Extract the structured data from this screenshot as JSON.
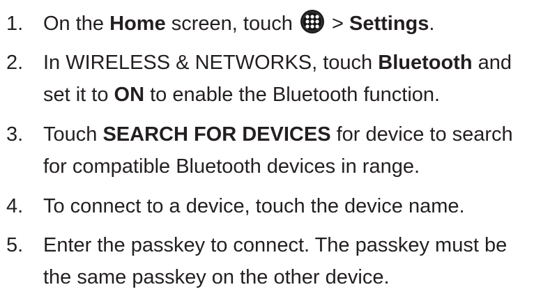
{
  "steps": [
    {
      "number": "1.",
      "lines": [
        {
          "before": "On the ",
          "bold1": "Home",
          "middle": " screen, touch ",
          "icon": "apps-grid-icon",
          "after": " > ",
          "bold2": "Settings",
          "end": "."
        }
      ]
    },
    {
      "number": "2.",
      "line1": {
        "before": "In WIRELESS & NETWORKS, touch ",
        "bold": "Bluetooth",
        "after": " and"
      },
      "line2": {
        "before": "set it to ",
        "bold": "ON",
        "after": " to enable the Bluetooth function."
      }
    },
    {
      "number": "3.",
      "line1": {
        "before": "Touch ",
        "bold": "SEARCH FOR DEVICES",
        "after": " for device to search"
      },
      "line2": {
        "text": "for compatible Bluetooth devices in range."
      }
    },
    {
      "number": "4.",
      "line1": {
        "text": "To connect to a device, touch the device name."
      }
    },
    {
      "number": "5.",
      "line1": {
        "text": "Enter the passkey to connect. The passkey must be"
      },
      "line2": {
        "text": "the same passkey on the other device."
      }
    }
  ]
}
